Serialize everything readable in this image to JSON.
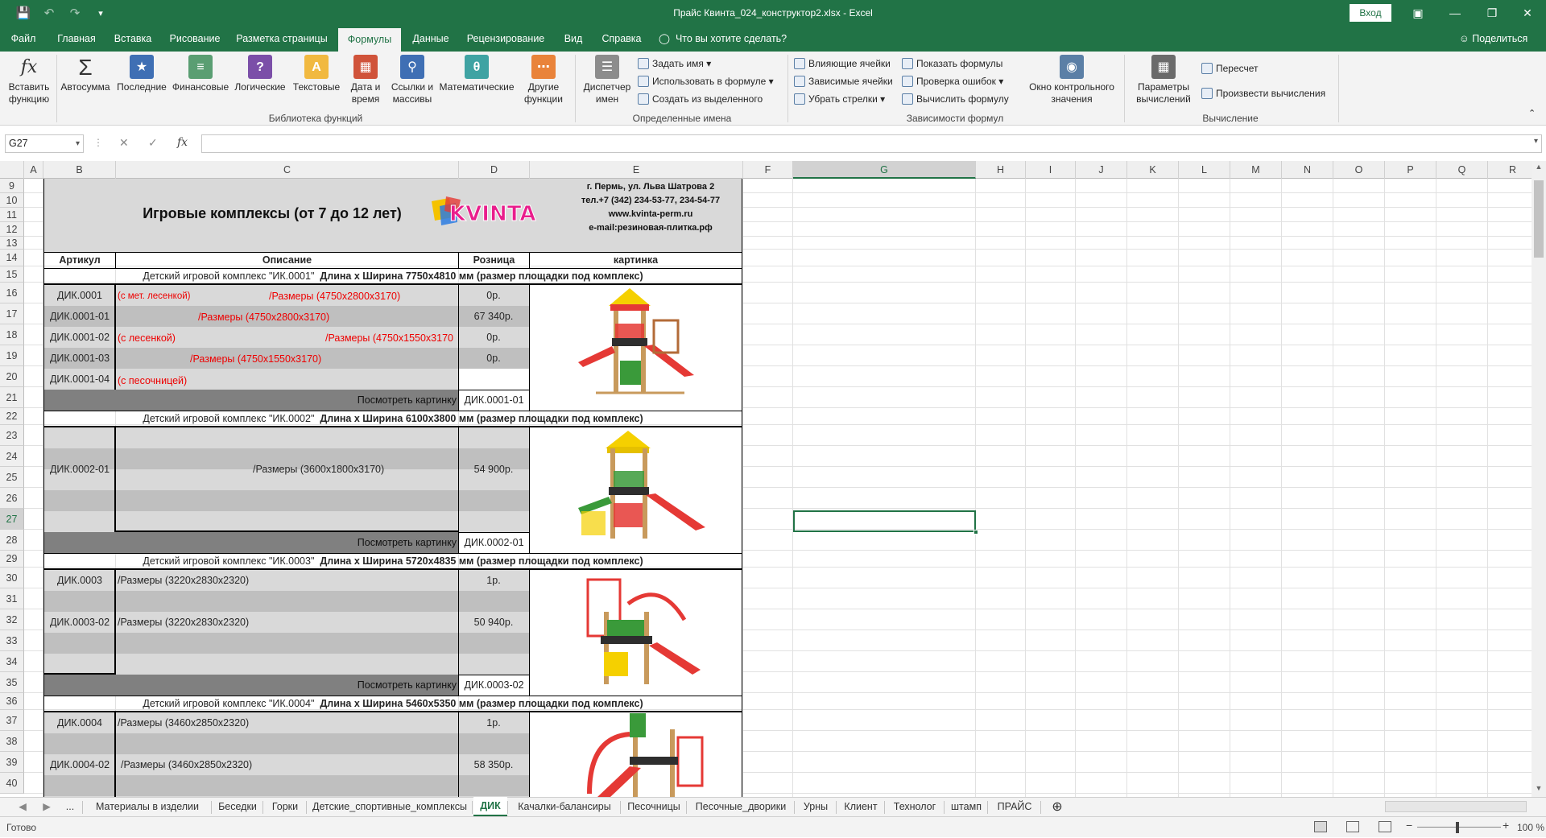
{
  "window": {
    "title": "Прайс Квинта_024_конструктор2.xlsx  -  Excel",
    "signin": "Вход"
  },
  "ribbon_tabs": [
    "Файл",
    "Главная",
    "Вставка",
    "Рисование",
    "Разметка страницы",
    "Формулы",
    "Данные",
    "Рецензирование",
    "Вид",
    "Справка"
  ],
  "active_tab": "Формулы",
  "tell_me": "Что вы хотите сделать?",
  "share": "Поделиться",
  "ribbon": {
    "insert_function": "Вставить функцию",
    "autosum": "Автосумма",
    "recent": "Последние",
    "financial": "Финансовые",
    "logical": "Логические",
    "text": "Текстовые",
    "datetime": "Дата и время",
    "lookup": "Ссылки и массивы",
    "math": "Математические",
    "other": "Другие функции",
    "group_library": "Библиотека функций",
    "name_manager": "Диспетчер имен",
    "define_name": "Задать имя",
    "use_in_formula": "Использовать в формуле",
    "create_from_sel": "Создать из выделенного",
    "group_names": "Определенные имена",
    "trace_precedents": "Влияющие ячейки",
    "trace_dependents": "Зависимые ячейки",
    "remove_arrows": "Убрать стрелки",
    "show_formulas": "Показать формулы",
    "error_check": "Проверка ошибок",
    "evaluate": "Вычислить формулу",
    "watch_window": "Окно контрольного значения",
    "group_audit": "Зависимости формул",
    "calc_options": "Параметры вычислений",
    "calc_now": "Пересчет",
    "calc_sheet": "Произвести вычисления",
    "group_calc": "Вычисление"
  },
  "namebox": "G27",
  "formula": "",
  "columns": [
    "A",
    "B",
    "C",
    "D",
    "E",
    "F",
    "G",
    "H",
    "I",
    "J",
    "K",
    "L",
    "M",
    "N",
    "O",
    "P",
    "Q",
    "R"
  ],
  "rows": [
    "9",
    "10",
    "11",
    "12",
    "13",
    "14",
    "15",
    "16",
    "17",
    "18",
    "19",
    "20",
    "21",
    "22",
    "23",
    "24",
    "25",
    "26",
    "27",
    "28",
    "29",
    "30",
    "31",
    "32",
    "33",
    "34",
    "35",
    "36",
    "37",
    "38",
    "39",
    "40"
  ],
  "header": {
    "title": "Игровые комплексы (от 7 до 12 лет)",
    "logo": "KVINTA",
    "address": "г. Пермь, ул. Льва Шатрова 2",
    "phone": "тел.+7 (342) 234-53-77, 234-54-77",
    "site": "www.kvinta-perm.ru",
    "email": "e-mail:резиновая-плитка.рф"
  },
  "col_headers": {
    "article": "Артикул",
    "desc": "Описание",
    "retail": "Розница",
    "picture": "картинка"
  },
  "products": [
    {
      "title": "Детский игровой комплекс \"ИК.0001\"",
      "dims": "Длина х Ширина 7750х4810 мм (размер площадки под комплекс)",
      "lines": [
        {
          "art": "ДИК.0001",
          "desc1": "(с мет. лесенкой)",
          "desc2": "/Размеры (4750х2800х3170)",
          "price": "0р."
        },
        {
          "art": "ДИК.0001-01",
          "desc1": "",
          "desc2": "/Размеры (4750х2800х3170)",
          "price": "67 340р."
        },
        {
          "art": "ДИК.0001-02",
          "desc1": "(с лесенкой)",
          "desc2": "/Размеры (4750х1550х3170",
          "price": "0р."
        },
        {
          "art": "ДИК.0001-03",
          "desc1": "",
          "desc2": "/Размеры (4750х1550х3170)",
          "price": "0р."
        },
        {
          "art": "ДИК.0001-04",
          "desc1": "(с песочницей)",
          "desc2": "",
          "price": ""
        }
      ],
      "view": "Посмотреть картинку",
      "link": "ДИК.0001-01"
    },
    {
      "title": "Детский игровой комплекс \"ИК.0002\"",
      "dims": "Длина х Ширина  6100х3800 мм (размер площадки под комплекс)",
      "art": "ДИК.0002-01",
      "desc": "/Размеры (3600х1800х3170)",
      "price": "54 900р.",
      "view": "Посмотреть картинку",
      "link": "ДИК.0002-01"
    },
    {
      "title": "Детский игровой комплекс \"ИК.0003\"",
      "dims": "Длина х Ширина  5720х4835 мм (размер площадки под комплекс)",
      "art1": "ДИК.0003",
      "desc1": "/Размеры (3220х2830х2320)",
      "price1": "1р.",
      "art2": "ДИК.0003-02",
      "desc2": "/Размеры (3220х2830х2320)",
      "price2": "50 940р.",
      "view": "Посмотреть картинку",
      "link": "ДИК.0003-02"
    },
    {
      "title": "Детский игровой комплекс \"ИК.0004\"",
      "dims": "Длина х Ширина  5460х5350 мм (размер площадки под комплекс)",
      "art1": "ДИК.0004",
      "desc1": "/Размеры (3460х2850х2320)",
      "price1": "1р.",
      "art2": "ДИК.0004-02",
      "desc2": "/Размеры (3460х2850х2320)",
      "price2": "58 350р."
    }
  ],
  "sheet_tabs": [
    "...",
    "Материалы в изделии",
    "Беседки",
    "Горки",
    "Детские_спортивные_комплексы",
    "ДИК",
    "Качалки-балансиры",
    "Песочницы",
    "Песочные_дворики",
    "Урны",
    "Клиент",
    "Технолог",
    "штамп",
    "ПРАЙС"
  ],
  "active_sheet": "ДИК",
  "status": {
    "ready": "Готово",
    "zoom": "100 %"
  }
}
